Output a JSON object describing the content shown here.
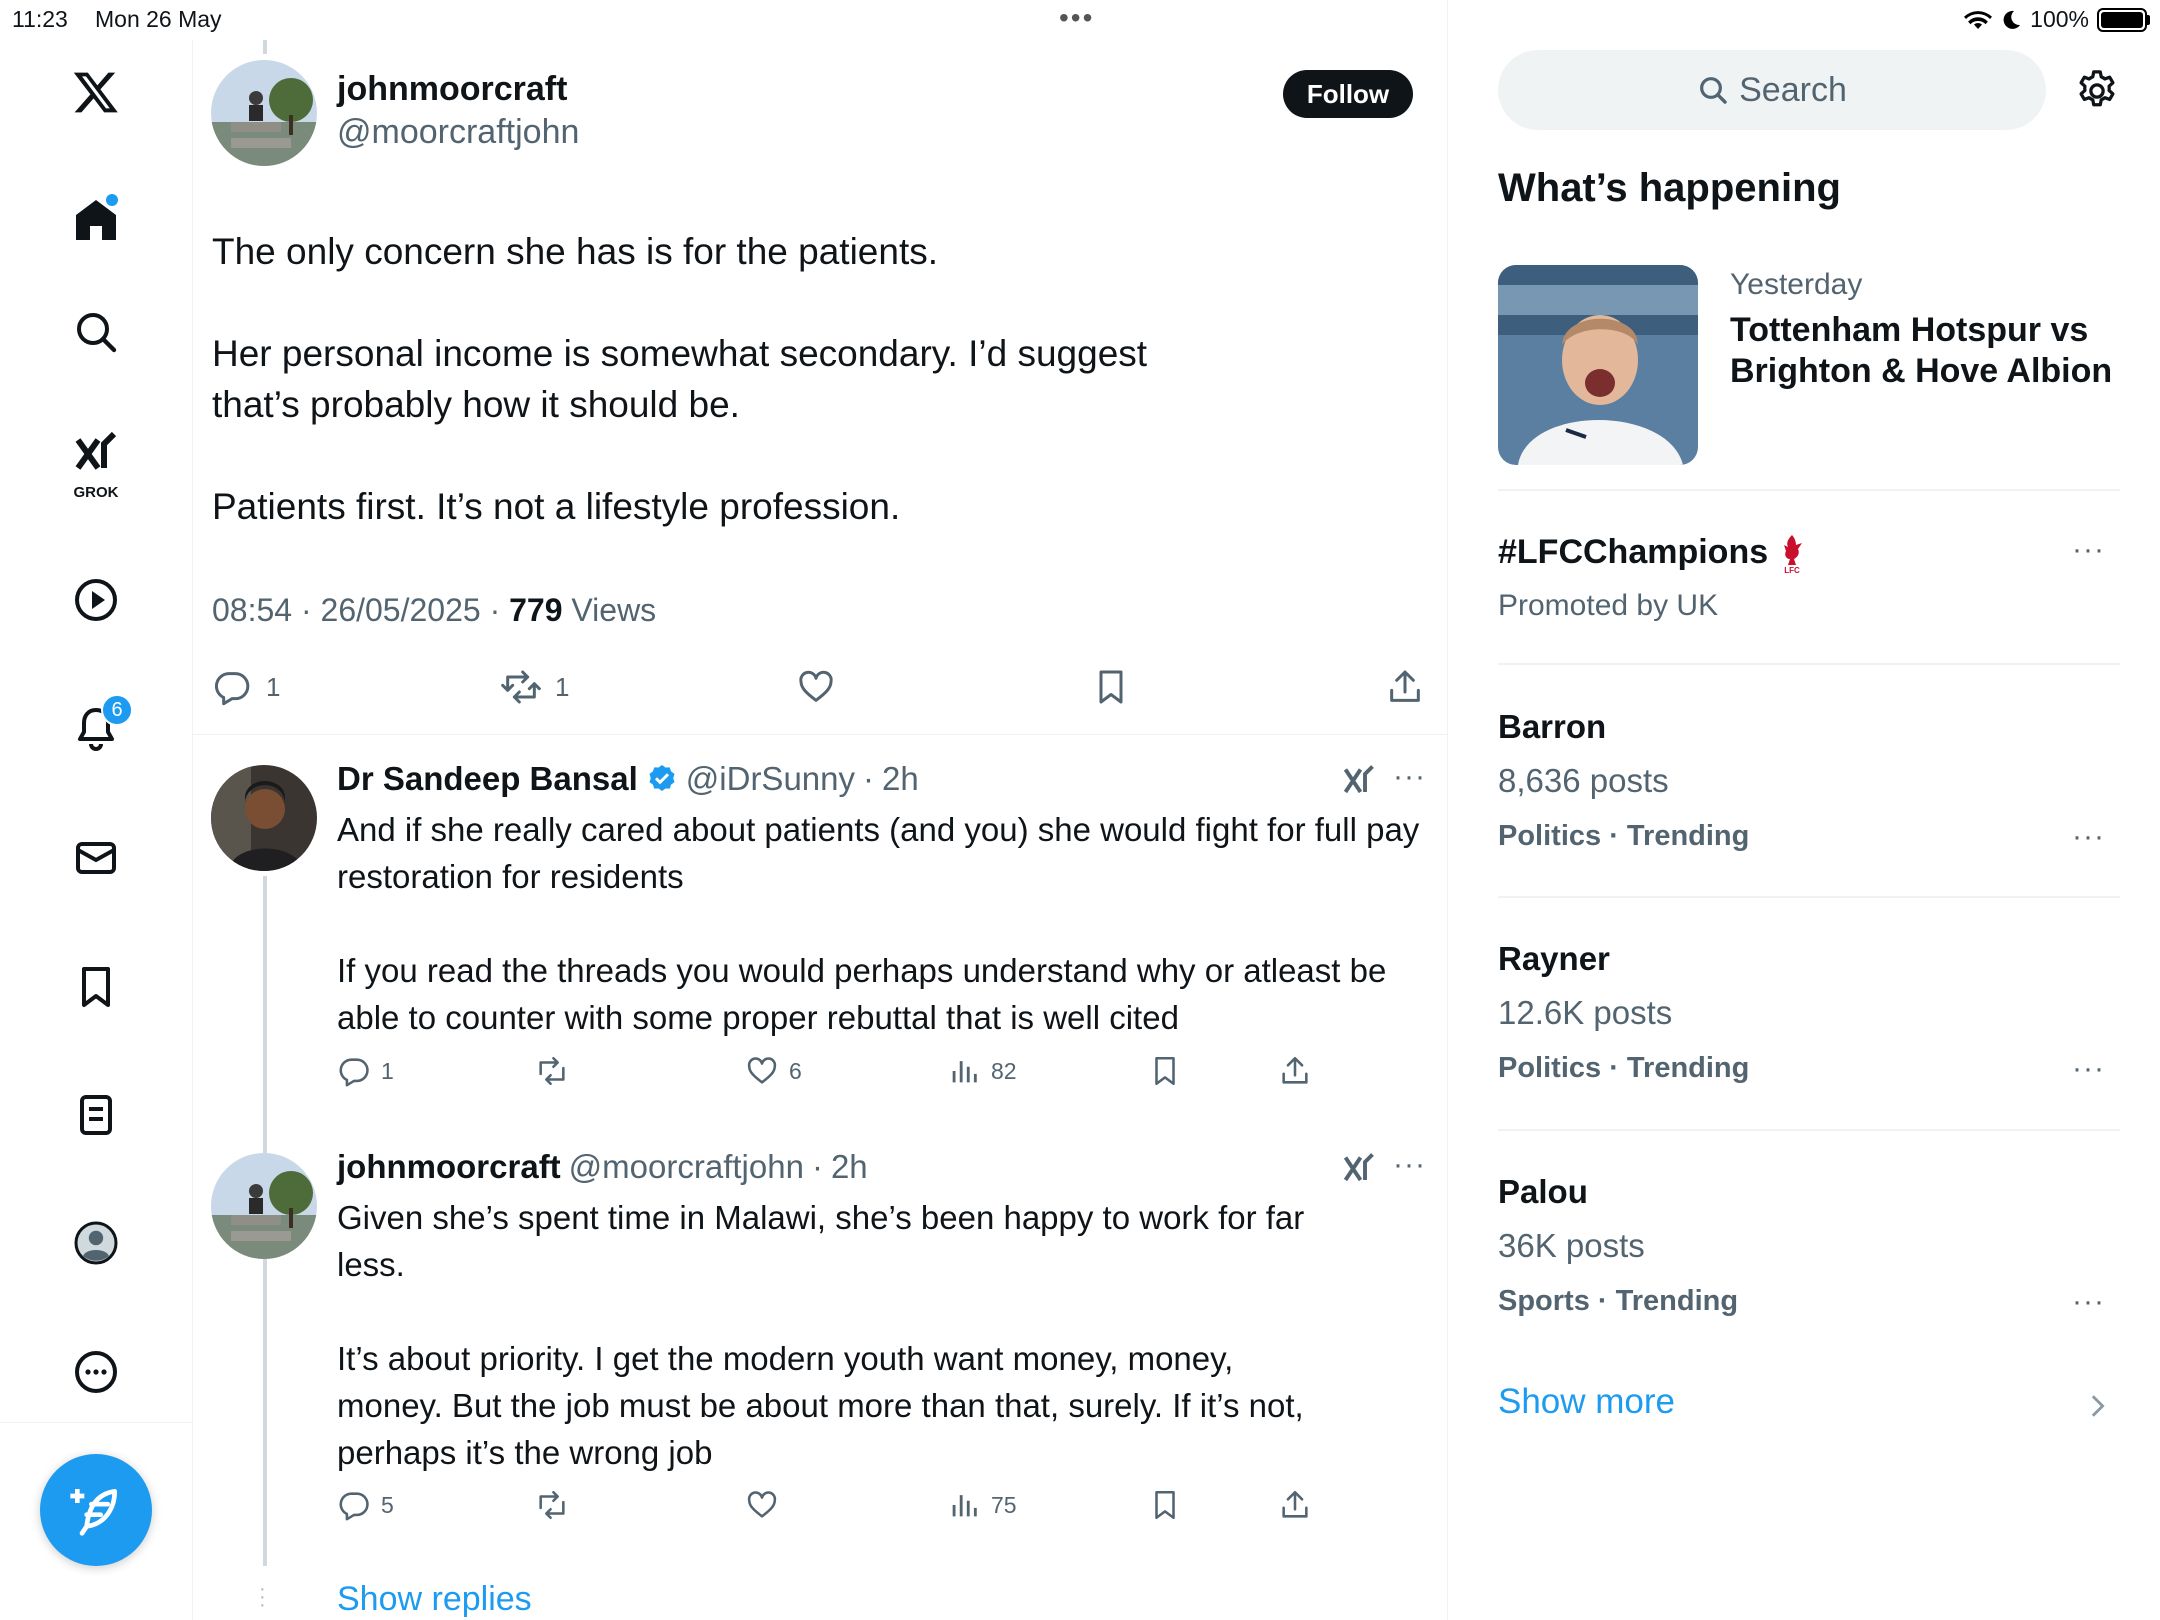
{
  "status_bar": {
    "time": "11:23",
    "date": "Mon 26 May",
    "battery": "100%"
  },
  "nav": {
    "grok_label": "GROK",
    "notifications_badge": "6"
  },
  "tweet": {
    "author_name": "johnmoorcraft",
    "author_handle": "@moorcraftjohn",
    "follow_label": "Follow",
    "text": "The only concern she has is for the patients.\n\nHer personal income is somewhat secondary. I’d suggest that’s probably how it should be.\n\nPatients first. It’s not a lifestyle profession.",
    "time": "08:54",
    "date": "26/05/2025",
    "views_count": "779",
    "views_label": "Views",
    "reply_count": "1",
    "retweet_count": "1"
  },
  "replies": [
    {
      "name": "Dr Sandeep Bansal",
      "handle": "@iDrSunny",
      "time": "2h",
      "text": "And if she really cared about patients (and you) she would fight for full pay restoration for residents\n\nIf you read the threads you would perhaps understand why or atleast be able to counter with some proper rebuttal that is well cited",
      "reply_count": "1",
      "like_count": "6",
      "view_count": "82"
    },
    {
      "name": "johnmoorcraft",
      "handle": "@moorcraftjohn",
      "time": "2h",
      "text": "Given she’s spent time in Malawi, she’s been happy to work for far less.\n\nIt’s about priority. I get the modern youth want money, money, money. But the job must be about more than that, surely. If it’s not, perhaps it’s the wrong job",
      "reply_count": "5",
      "view_count": "75"
    }
  ],
  "show_replies_label": "Show replies",
  "sidebar": {
    "search_placeholder": "Search",
    "section_title": "What’s happening",
    "featured": {
      "label": "Yesterday",
      "title": "Tottenham Hotspur vs Brighton & Hove Albion"
    },
    "promoted": {
      "tag": "#LFCChampions",
      "label": "Promoted by UK"
    },
    "trends": [
      {
        "name": "Barron",
        "posts": "8,636 posts",
        "category": "Politics · Trending"
      },
      {
        "name": "Rayner",
        "posts": "12.6K posts",
        "category": "Politics · Trending"
      },
      {
        "name": "Palou",
        "posts": "36K posts",
        "category": "Sports · Trending"
      }
    ],
    "show_more_label": "Show more"
  }
}
